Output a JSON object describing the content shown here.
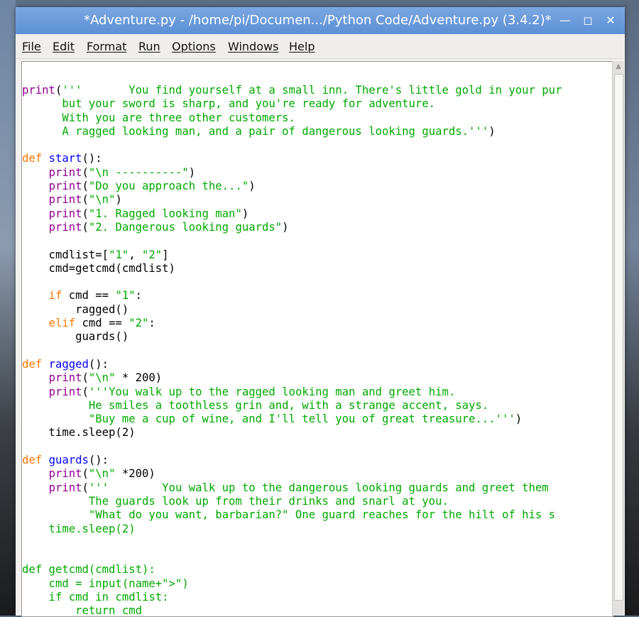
{
  "window": {
    "title": "*Adventure.py - /home/pi/Documen.../Python Code/Adventure.py (3.4.2)*",
    "buttons": {
      "minimize": "—",
      "maximize": "◻",
      "close": "✕"
    }
  },
  "menu": [
    "File",
    "Edit",
    "Format",
    "Run",
    "Options",
    "Windows",
    "Help"
  ],
  "colors": {
    "keyword": "#ff7700",
    "builtin": "#900090",
    "string": "#00aa00",
    "definition": "#0000ff",
    "titlebar": "#5c8fd6"
  },
  "code_lines": [
    "print('''       You find yourself at a small inn. There's little gold in your pur",
    "      but your sword is sharp, and you're ready for adventure.",
    "      With you are three other customers.",
    "      A ragged looking man, and a pair of dangerous looking guards.''')",
    "",
    "def start():",
    "    print(\"\\n ----------\")",
    "    print(\"Do you approach the...\")",
    "    print(\"\\n\")",
    "    print(\"1. Ragged looking man\")",
    "    print(\"2. Dangerous looking guards\")",
    "",
    "    cmdlist=[\"1\", \"2\"]",
    "    cmd=getcmd(cmdlist)",
    "",
    "    if cmd == \"1\":",
    "        ragged()",
    "    elif cmd == \"2\":",
    "        guards()",
    "",
    "def ragged():",
    "    print(\"\\n\" * 200)",
    "    print('''You walk up to the ragged looking man and greet him.",
    "          He smiles a toothless grin and, with a strange accent, says.",
    "          \"Buy me a cup of wine, and I'll tell you of great treasure...''')",
    "    time.sleep(2)",
    "",
    "def guards():",
    "    print(\"\\n\" *200)",
    "    print('''        You walk up to the dangerous looking guards and greet them",
    "          The guards look up from their drinks and snarl at you.",
    "          \"What do you want, barbarian?\" One guard reaches for the hilt of his s",
    "    time.sleep(2)",
    "",
    "",
    "def getcmd(cmdlist):",
    "    cmd = input(name+\">\")",
    "    if cmd in cmdlist:",
    "        return cmd"
  ]
}
